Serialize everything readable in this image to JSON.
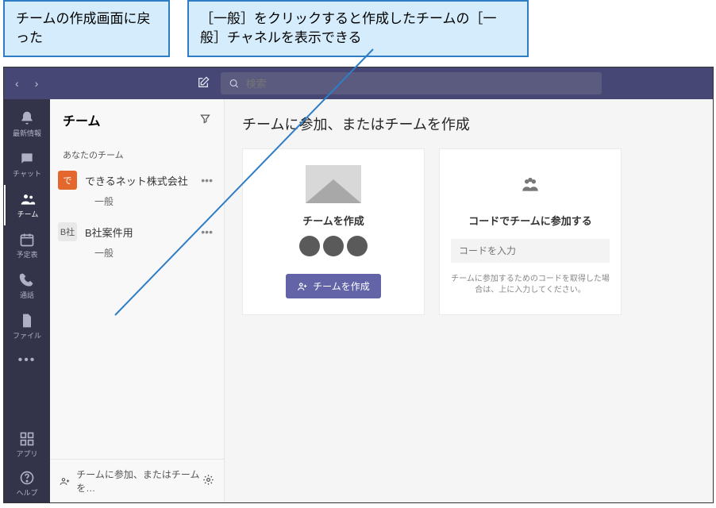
{
  "callouts": {
    "left": "チームの作成画面に戻った",
    "right": "［一般］をクリックすると作成したチームの［一般］チャネルを表示できる"
  },
  "search": {
    "placeholder": "検索"
  },
  "rail": {
    "activity": "最新情報",
    "chat": "チャット",
    "teams": "チーム",
    "calendar": "予定表",
    "calls": "通話",
    "files": "ファイル",
    "apps": "アプリ",
    "help": "ヘルプ"
  },
  "sidebar": {
    "title": "チーム",
    "section": "あなたのチーム",
    "teams": [
      {
        "badge": "で",
        "name": "できるネット株式会社",
        "channel": "一般"
      },
      {
        "badge": "B社",
        "name": "B社案件用",
        "channel": "一般"
      }
    ],
    "footer": "チームに参加、またはチームを…"
  },
  "main": {
    "heading": "チームに参加、またはチームを作成",
    "create_card": {
      "title": "チームを作成",
      "button": "チームを作成"
    },
    "join_card": {
      "title": "コードでチームに参加する",
      "placeholder": "コードを入力",
      "note": "チームに参加するためのコードを取得した場合は、上に入力してください。"
    }
  }
}
